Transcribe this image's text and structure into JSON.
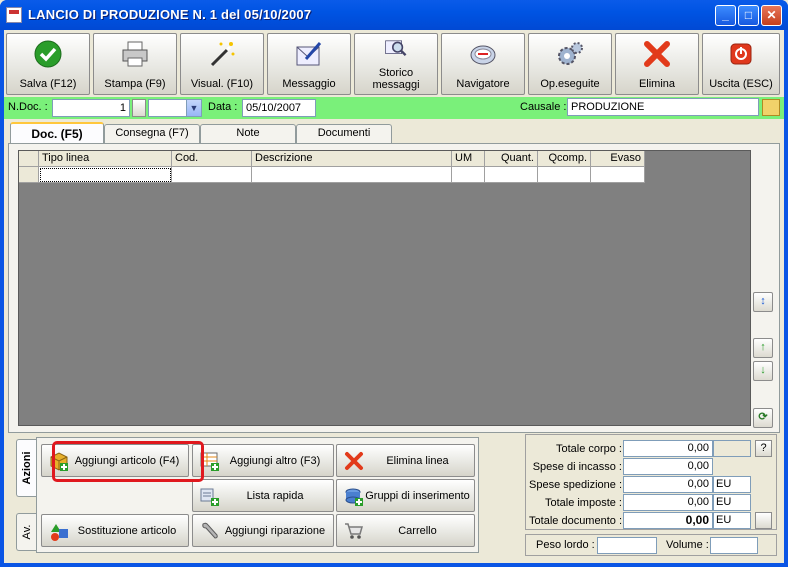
{
  "window": {
    "title": "LANCIO DI PRODUZIONE N. 1   del 05/10/2007",
    "minimize": "_",
    "maximize": "□",
    "close": "✕"
  },
  "toolbar": [
    {
      "label": "Salva (F12)",
      "icon": "check-icon"
    },
    {
      "label": "Stampa (F9)",
      "icon": "printer-icon"
    },
    {
      "label": "Visual. (F10)",
      "icon": "magic-wand-icon"
    },
    {
      "label": "Messaggio",
      "icon": "pen-message-icon"
    },
    {
      "label": "Storico messaggi",
      "icon": "message-history-icon"
    },
    {
      "label": "Navigatore",
      "icon": "compass-icon"
    },
    {
      "label": "Op.eseguite",
      "icon": "gears-icon"
    },
    {
      "label": "Elimina",
      "icon": "red-x-icon"
    },
    {
      "label": "Uscita (ESC)",
      "icon": "power-icon"
    }
  ],
  "docbar": {
    "ndoc_label": "N.Doc. :",
    "ndoc_value": "1",
    "data_label": "Data :",
    "data_value": "05/10/2007",
    "causale_label": "Causale :",
    "causale_value": "PRODUZIONE"
  },
  "tabs": [
    "Doc. (F5)",
    "Consegna (F7)",
    "Note",
    "Documenti"
  ],
  "grid": {
    "columns": [
      "Tipo linea",
      "Cod.",
      "Descrizione",
      "UM",
      "Quant.",
      "Qcomp.",
      "Evaso"
    ],
    "rows": [
      [
        "",
        "",
        "",
        "",
        "",
        "",
        ""
      ]
    ]
  },
  "side_buttons": [
    "↕",
    "↑",
    "↓",
    "⟳"
  ],
  "actions": {
    "vtabs": [
      "Azioni",
      "Av."
    ],
    "buttons": [
      {
        "label": "Aggiungi articolo (F4)",
        "icon": "add-box-icon"
      },
      {
        "label": "Aggiungi altro (F3)",
        "icon": "add-table-icon"
      },
      {
        "label": "Elimina linea",
        "icon": "delete-line-icon"
      },
      {
        "label": "Lista rapida",
        "icon": "quick-list-icon"
      },
      {
        "label": "Gruppi di inserimento",
        "icon": "group-insert-icon"
      },
      {
        "label": "Sostituzione articolo",
        "icon": "replace-shapes-icon"
      },
      {
        "label": "Aggiungi riparazione",
        "icon": "wrench-icon"
      },
      {
        "label": "Carrello",
        "icon": "cart-icon"
      }
    ]
  },
  "totals": [
    {
      "label": "Totale corpo :",
      "value": "0,00",
      "unit": "",
      "bold": false
    },
    {
      "label": "Spese di incasso :",
      "value": "0,00",
      "unit": "",
      "bold": false
    },
    {
      "label": "Spese spedizione :",
      "value": "0,00",
      "unit": "EU",
      "bold": false
    },
    {
      "label": "Totale imposte :",
      "value": "0,00",
      "unit": "EU",
      "bold": false
    },
    {
      "label": "Totale documento :",
      "value": "0,00",
      "unit": "EU",
      "bold": true
    }
  ],
  "help_button": "?",
  "weights": {
    "peso_label": "Peso lordo :",
    "peso_value": "",
    "volume_label": "Volume :",
    "volume_value": ""
  }
}
